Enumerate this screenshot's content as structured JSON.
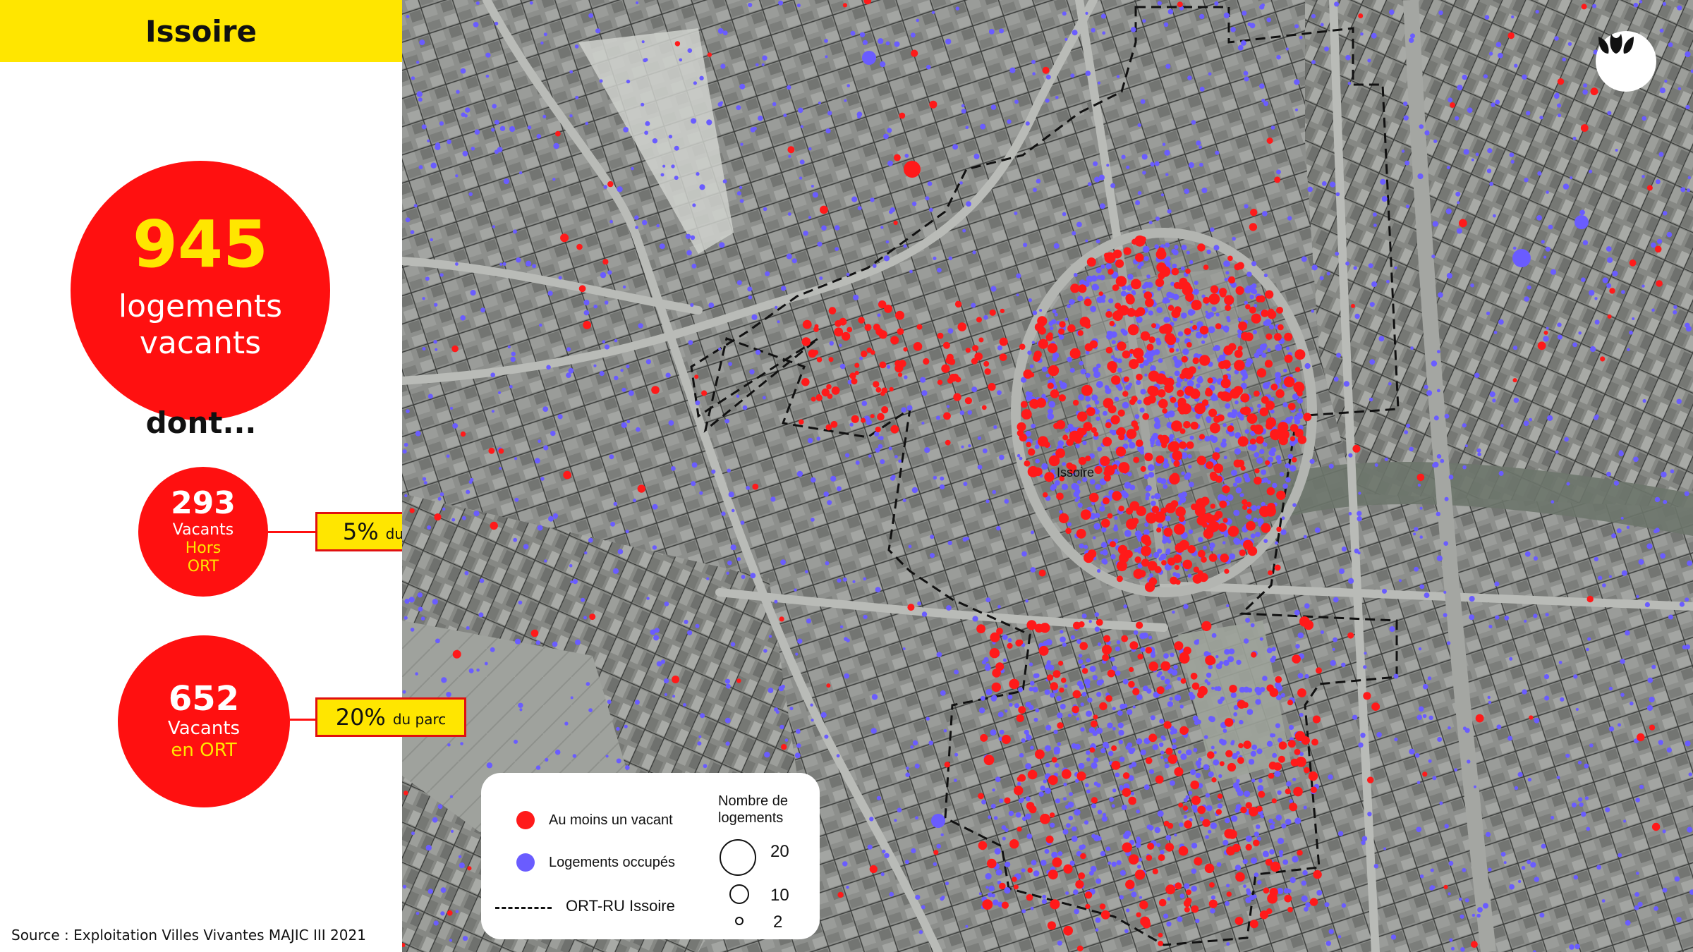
{
  "title": "Issoire",
  "total": {
    "value": "945",
    "label_line1": "logements",
    "label_line2": "vacants"
  },
  "dont": "dont...",
  "hors_ort": {
    "value": "293",
    "line1": "Vacants",
    "line2": "Hors",
    "line3": "ORT",
    "percent": "5%",
    "percent_suffix": "du parc"
  },
  "en_ort": {
    "value": "652",
    "line1": "Vacants",
    "line2": "en ORT",
    "percent": "20%",
    "percent_suffix": "du parc"
  },
  "source": "Source : Exploitation Villes Vivantes MAJIC III 2021",
  "map": {
    "town_label": "Issoire",
    "logo": "villes-vivantes-logo",
    "colors": {
      "vacant": "#ff1a1a",
      "occupied": "#6a5cff",
      "highlight": "#ffe600",
      "accent_red": "#ff1010"
    }
  },
  "legend": {
    "vacant": "Au moins un vacant",
    "occupied": "Logements occupés",
    "ort": "ORT-RU Issoire",
    "size_title_line1": "Nombre de",
    "size_title_line2": "logements",
    "sizes": [
      "20",
      "10",
      "2"
    ]
  }
}
